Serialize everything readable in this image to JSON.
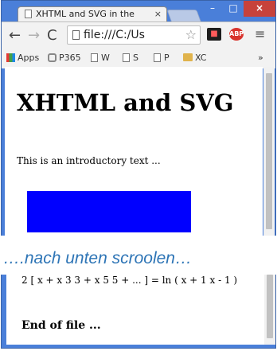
{
  "window": {
    "tab_title": "XHTML and SVG in the",
    "tab_close": "×",
    "min_label": "–",
    "max_label": "□",
    "close_label": "×"
  },
  "toolbar": {
    "back": "←",
    "forward": "→",
    "reload": "C",
    "url": "file:///C:/Us",
    "star": "☆",
    "menu": "≡",
    "ext_abp": "ABP"
  },
  "bookmarks": [
    {
      "label": "Apps"
    },
    {
      "label": "P365"
    },
    {
      "label": "W"
    },
    {
      "label": "S"
    },
    {
      "label": "P"
    },
    {
      "label": "XC"
    },
    {
      "label": "»"
    }
  ],
  "page": {
    "heading": "XHTML and SVG",
    "intro": "This is an introductory text ...",
    "formula": "2 [ x + x 3 3 + x 5 5 + ... ] = ln ( x + 1 x - 1 )",
    "end": "End of file ..."
  },
  "caption": "….nach unten scroolen…",
  "colors": {
    "chrome_frame": "#4a7fd9",
    "blue_rect": "#0000ff",
    "caption": "#2e75b6",
    "close_button": "#c7423b"
  }
}
